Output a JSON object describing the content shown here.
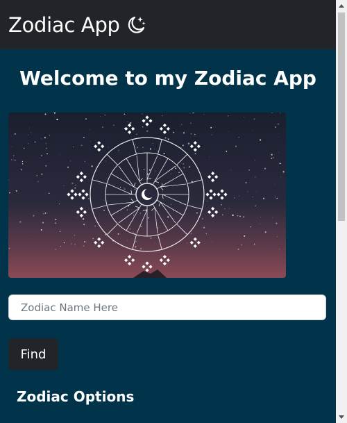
{
  "navbar": {
    "brand_text": "Zodiac App",
    "icon": "moon-stars-icon",
    "background": "#212529"
  },
  "main": {
    "heading": "Welcome to my Zodiac App",
    "hero_image_alt": "zodiac-wheel-night-sky",
    "search": {
      "placeholder": "Zodiac Name Here",
      "value": ""
    },
    "find_button_label": "Find",
    "section_title": "Zodiac Options",
    "background": "#01344a"
  }
}
